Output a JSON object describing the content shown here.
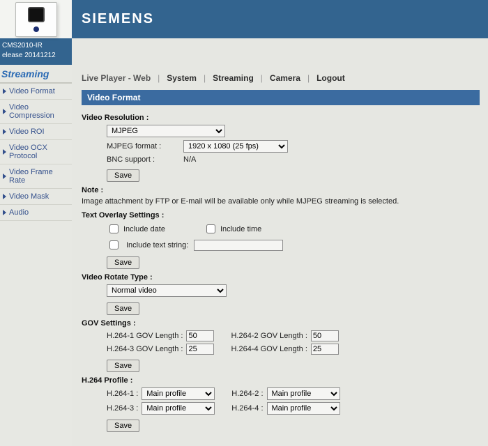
{
  "brand": "SIEMENS",
  "device": {
    "model": "CMS2010-IR",
    "release": "elease 20141212"
  },
  "topnav": {
    "live": "Live Player - Web",
    "system": "System",
    "streaming": "Streaming",
    "camera": "Camera",
    "logout": "Logout"
  },
  "sidebar": {
    "title": "Streaming",
    "items": [
      "Video Format",
      "Video Compression",
      "Video ROI",
      "Video OCX Protocol",
      "Video Frame Rate",
      "Video Mask",
      "Audio"
    ]
  },
  "section_title": "Video Format",
  "res": {
    "label": "Video Resolution :",
    "codec": "MJPEG",
    "fmt_label": "MJPEG format :",
    "fmt_value": "1920 x 1080 (25 fps)",
    "bnc_label": "BNC support :",
    "bnc_value": "N/A",
    "save": "Save"
  },
  "note": {
    "label": "Note :",
    "text": "Image attachment by FTP or E-mail will be available only while MJPEG streaming is selected."
  },
  "overlay": {
    "label": "Text Overlay Settings :",
    "include_date": "Include date",
    "include_time": "Include time",
    "include_text": "Include text string:",
    "text_value": "",
    "save": "Save"
  },
  "rotate": {
    "label": "Video Rotate Type :",
    "value": "Normal video",
    "save": "Save"
  },
  "gov": {
    "label": "GOV Settings :",
    "l": [
      {
        "name": "H.264-1 GOV Length :",
        "val": "50"
      },
      {
        "name": "H.264-2 GOV Length :",
        "val": "50"
      },
      {
        "name": "H.264-3 GOV Length :",
        "val": "25"
      },
      {
        "name": "H.264-4 GOV Length :",
        "val": "25"
      }
    ],
    "save": "Save"
  },
  "profile": {
    "label": "H.264 Profile :",
    "p": [
      {
        "name": "H.264-1 :",
        "val": "Main profile"
      },
      {
        "name": "H.264-2 :",
        "val": "Main profile"
      },
      {
        "name": "H.264-3 :",
        "val": "Main profile"
      },
      {
        "name": "H.264-4 :",
        "val": "Main profile"
      }
    ],
    "save": "Save"
  }
}
